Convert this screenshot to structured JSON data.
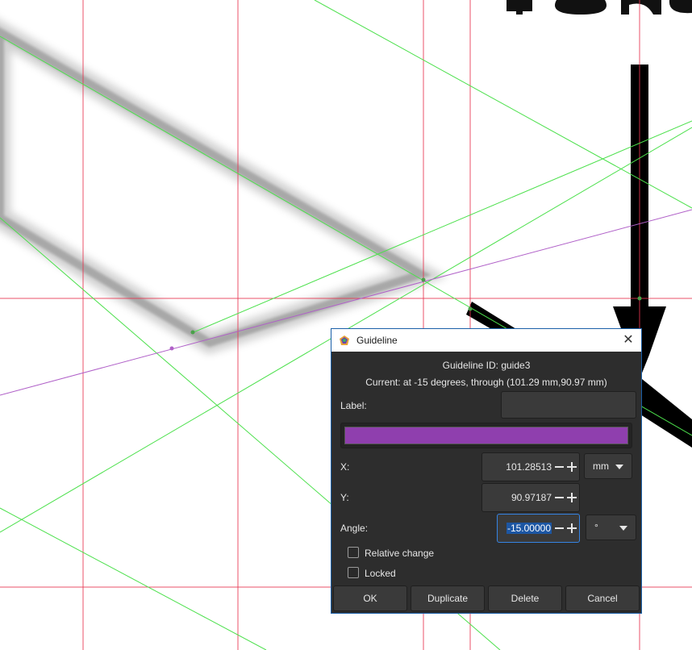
{
  "dialog": {
    "title": "Guideline",
    "close_icon": "close-icon",
    "app_icon": "inkscape-icon",
    "guideline_id": "Guideline ID: guide3",
    "current": "Current: at -15 degrees, through (101.29 mm,90.97 mm)",
    "label_label": "Label:",
    "label_value": "",
    "color": "#8f3fae",
    "x_label": "X:",
    "x_value": "101.28513",
    "y_label": "Y:",
    "y_value": "90.97187",
    "unit": "mm",
    "angle_label": "Angle:",
    "angle_value": "-15.00000",
    "angle_unit": "°",
    "relative_change": "Relative change",
    "locked": "Locked",
    "ok": "OK",
    "duplicate": "Duplicate",
    "delete": "Delete",
    "cancel": "Cancel"
  },
  "colors": {
    "guide_red": "#e8344f",
    "guide_green": "#4ce04c",
    "guide_purple": "#b060c8",
    "accent": "#3584e4"
  },
  "canvas": {
    "partial_text": "Tone"
  }
}
